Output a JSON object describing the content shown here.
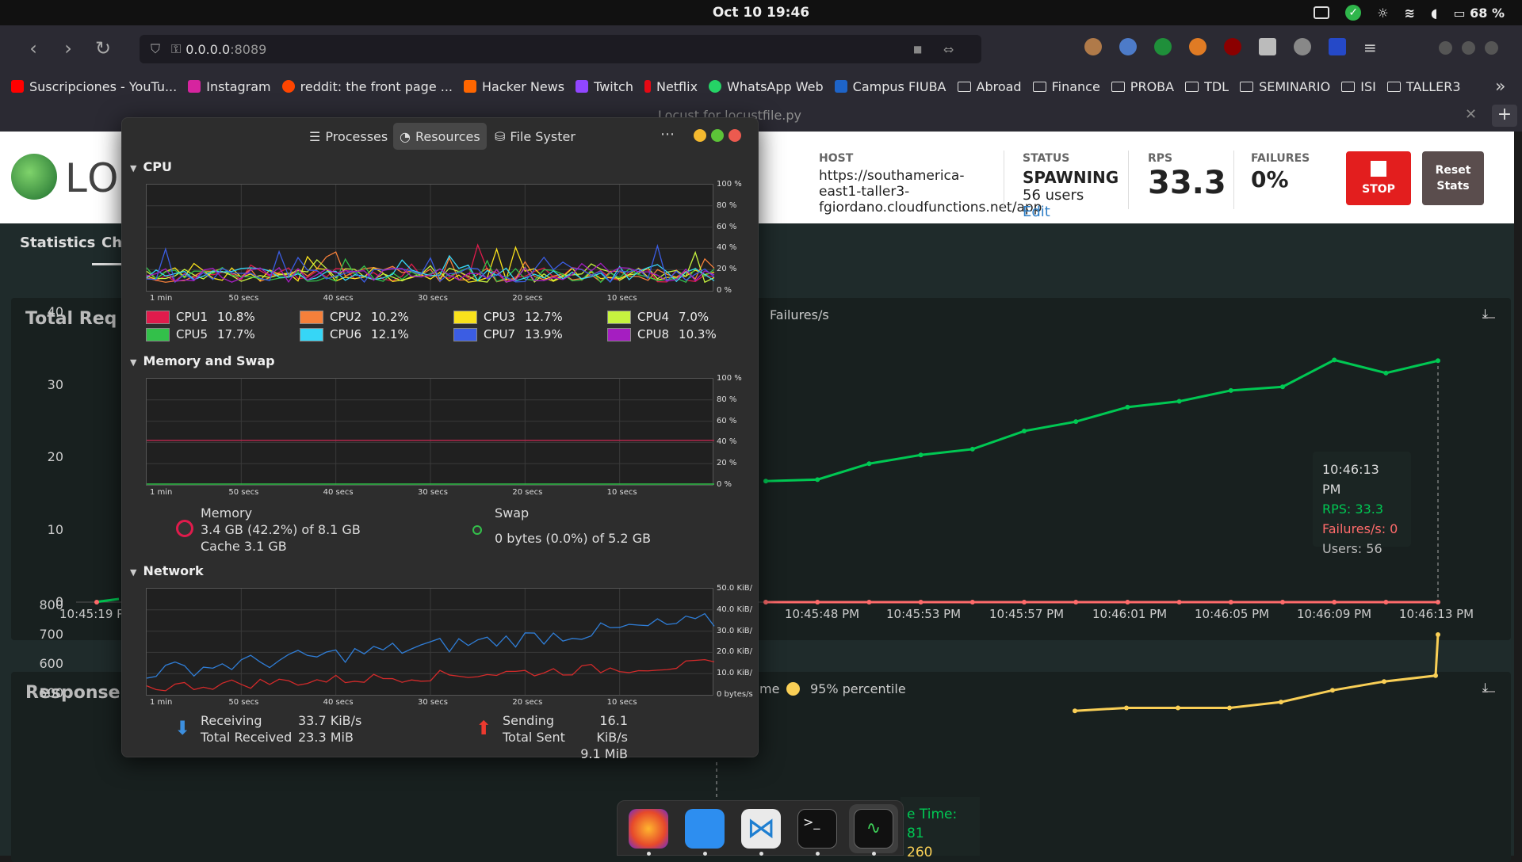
{
  "system_bar": {
    "datetime": "Oct 10  19:46",
    "battery": "68 %"
  },
  "browser": {
    "url_host": "0.0.0.0",
    "url_port": ":8089",
    "tab_title": "Locust for locustfile.py",
    "bookmarks": [
      {
        "label": "Suscripciones - YouTu...",
        "color": "#ff0000"
      },
      {
        "label": "Instagram",
        "color": "#d6249f"
      },
      {
        "label": "reddit: the front page ...",
        "color": "#ff4500"
      },
      {
        "label": "Hacker News",
        "color": "#ff6600"
      },
      {
        "label": "Twitch",
        "color": "#9146ff"
      },
      {
        "label": "Netflix",
        "color": "#e50914"
      },
      {
        "label": "WhatsApp Web",
        "color": "#25d366"
      },
      {
        "label": "Campus FIUBA",
        "color": "#1e64c8"
      }
    ],
    "folders": [
      "Abroad",
      "Finance",
      "PROBA",
      "TDL",
      "SEMINARIO",
      "ISI",
      "TALLER3"
    ]
  },
  "locust": {
    "logo_text": "LOC",
    "host_label": "HOST",
    "host_value": "https://southamerica-east1-taller3-fgiordano.cloudfunctions.net/app",
    "status_label": "STATUS",
    "status_value": "SPAWNING",
    "users_value": "56 users",
    "edit_label": "Edit",
    "rps_label": "RPS",
    "rps_value": "33.3",
    "failures_label": "FAILURES",
    "failures_value": "0%",
    "stop_label": "STOP",
    "reset_label": "Reset Stats",
    "tabs": [
      "Statistics",
      "Ch"
    ],
    "card1_title": "Total Req",
    "card2_title": "Response",
    "card1_legend_failures": "Failures/s",
    "card2_legend_p50": "me",
    "card2_legend_p95": "95% percentile",
    "tooltip": {
      "time": "10:46:13 PM",
      "rps": "RPS: 33.3",
      "failures": "Failures/s: 0",
      "users": "Users: 56"
    },
    "tooltip2": {
      "response": "e Time: 81",
      "p95": "260"
    },
    "colors": {
      "rps": "#00c853",
      "failures": "#ff6b6b",
      "p95": "#f9cf56"
    }
  },
  "chart_data": [
    {
      "type": "line",
      "title": "Total Req",
      "x": [
        "10:45:19 PM",
        "10:45:48 PM",
        "10:45:53 PM",
        "10:45:57 PM",
        "10:46:01 PM",
        "10:46:05 PM",
        "10:46:09 PM",
        "10:46:13 PM"
      ],
      "yticks": [
        0,
        10,
        20,
        30,
        40
      ],
      "ylim": [
        0,
        40
      ],
      "series": [
        {
          "name": "RPS",
          "color": "#00c853",
          "x": [
            "10:45:46",
            "10:45:48",
            "10:45:50",
            "10:45:52",
            "10:45:54",
            "10:45:56",
            "10:45:58",
            "10:46:00",
            "10:46:02",
            "10:46:04",
            "10:46:06",
            "10:46:08",
            "10:46:10",
            "10:46:12",
            "10:46:13"
          ],
          "values": [
            16.7,
            16.9,
            19.1,
            20.3,
            21.1,
            23.6,
            24.9,
            26.9,
            27.7,
            29.2,
            29.7,
            33.4,
            31.6,
            33.3,
            33.3
          ]
        },
        {
          "name": "Failures/s",
          "color": "#ff6b6b",
          "values": [
            0,
            0,
            0,
            0,
            0,
            0,
            0,
            0,
            0,
            0,
            0,
            0,
            0,
            0,
            0
          ]
        }
      ]
    },
    {
      "type": "line",
      "title": "Response",
      "yticks": [
        500,
        600,
        700,
        800
      ],
      "series": [
        {
          "name": "95% percentile",
          "color": "#f9cf56",
          "values": [
            440,
            450,
            450,
            450,
            470,
            510,
            540,
            560,
            700
          ]
        }
      ]
    }
  ],
  "monitor": {
    "tabs": [
      "Processes",
      "Resources",
      "File Syster"
    ],
    "cpu_title": "CPU",
    "mem_title": "Memory and Swap",
    "net_title": "Network",
    "pct_ticks": [
      "100 %",
      "80 %",
      "60 %",
      "40 %",
      "20 %",
      "0 %"
    ],
    "net_ticks": [
      "50.0 KiB/",
      "40.0 KiB/",
      "30.0 KiB/",
      "20.0 KiB/",
      "10.0 KiB/",
      "0 bytes/s"
    ],
    "time_ticks": [
      "1 min",
      "50 secs",
      "40 secs",
      "30 secs",
      "20 secs",
      "10 secs"
    ],
    "cpus": [
      {
        "label": "CPU1",
        "value": "10.8%",
        "color": "#e01b4c"
      },
      {
        "label": "CPU2",
        "value": "10.2%",
        "color": "#f6803a"
      },
      {
        "label": "CPU3",
        "value": "12.7%",
        "color": "#f9e21c"
      },
      {
        "label": "CPU4",
        "value": "7.0%",
        "color": "#c6f33f"
      },
      {
        "label": "CPU5",
        "value": "17.7%",
        "color": "#33c04a"
      },
      {
        "label": "CPU6",
        "value": "12.1%",
        "color": "#36d6f6"
      },
      {
        "label": "CPU7",
        "value": "13.9%",
        "color": "#3b5de3"
      },
      {
        "label": "CPU8",
        "value": "10.3%",
        "color": "#a51ec1"
      }
    ],
    "memory_label": "Memory",
    "memory_value": "3.4 GB (42.2%) of 8.1 GB",
    "cache_value": "Cache 3.1 GB",
    "swap_label": "Swap",
    "swap_value": "0 bytes (0.0%) of 5.2 GB",
    "receiving_label": "Receiving",
    "receiving_value": "33.7 KiB/s",
    "total_received_label": "Total Received",
    "total_received_value": "23.3 MiB",
    "sending_label": "Sending",
    "sending_value": "16.1 KiB/s",
    "total_sent_label": "Total Sent",
    "total_sent_value": "9.1 MiB"
  },
  "dock": {
    "apps": [
      "firefox-icon",
      "files-icon",
      "vscode-icon",
      "terminal-icon",
      "system-monitor-icon"
    ]
  }
}
